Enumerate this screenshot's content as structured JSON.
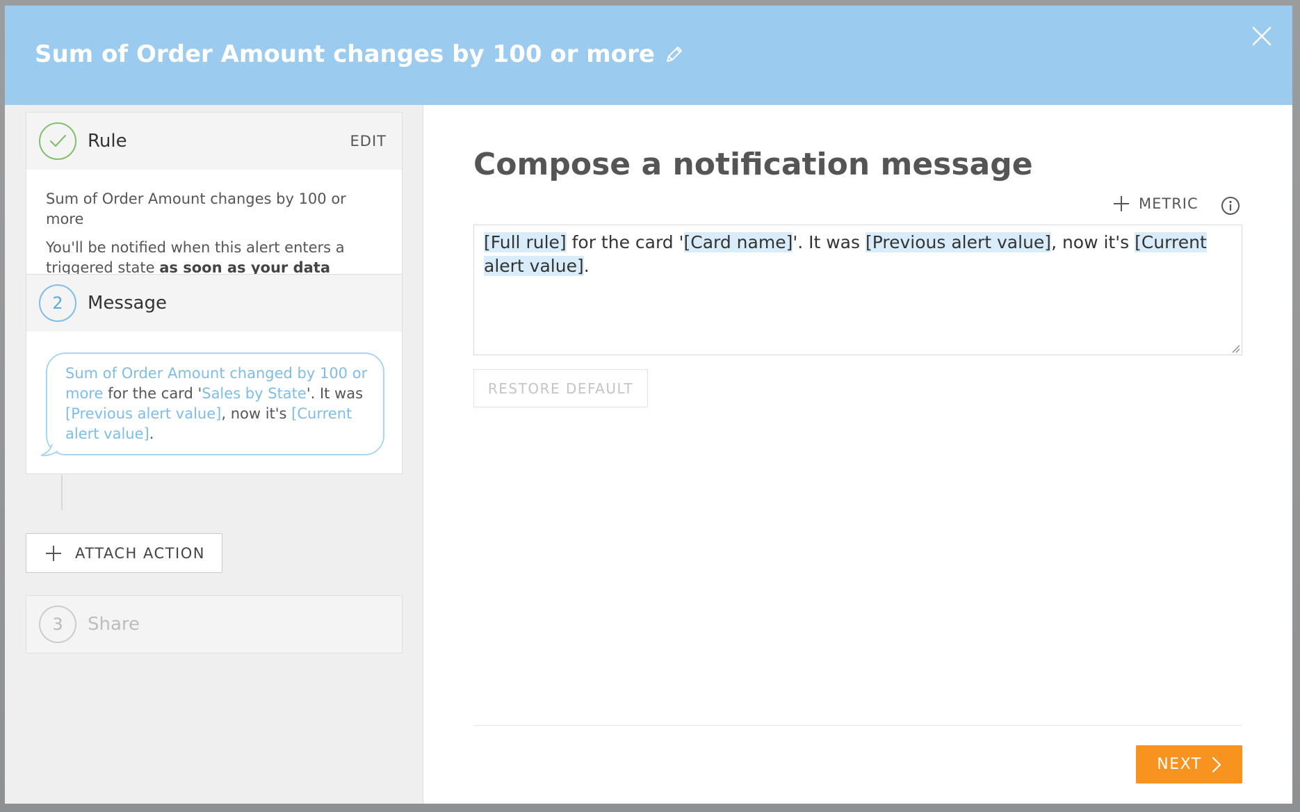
{
  "header": {
    "title": "Sum of Order Amount changes by 100 or more",
    "accent_color": "#9bcbee"
  },
  "steps": {
    "rule": {
      "title": "Rule",
      "edit_label": "EDIT",
      "summary": "Sum of Order Amount changes by 100 or more",
      "notify_text": "You'll be notified when this alert enters a triggered state ",
      "notify_bold": "as soon as your data updates",
      "status_icon": "check-icon"
    },
    "message": {
      "number": "2",
      "title": "Message",
      "preview": {
        "token1": "Sum of Order Amount changed by 100 or more",
        "text1": " for the card '",
        "token2": "Sales by State",
        "text2": "'. It was ",
        "token3": "[Previous alert value]",
        "text3": ", now it's ",
        "token4": "[Current alert value]",
        "text4": "."
      }
    },
    "attach_action_label": "ATTACH ACTION",
    "share": {
      "number": "3",
      "title": "Share"
    }
  },
  "main": {
    "title": "Compose a notification message",
    "metric_label": "METRIC",
    "message": {
      "token1": "[Full rule]",
      "text1": " for the card '",
      "token2": "[Card name]",
      "text2": "'.  It was ",
      "token3": "[Previous alert value]",
      "text3": ", now it's ",
      "token4": "[Current alert value]",
      "text4": "."
    },
    "restore_label": "RESTORE DEFAULT",
    "next_label": "NEXT",
    "next_color": "#f7931e"
  }
}
